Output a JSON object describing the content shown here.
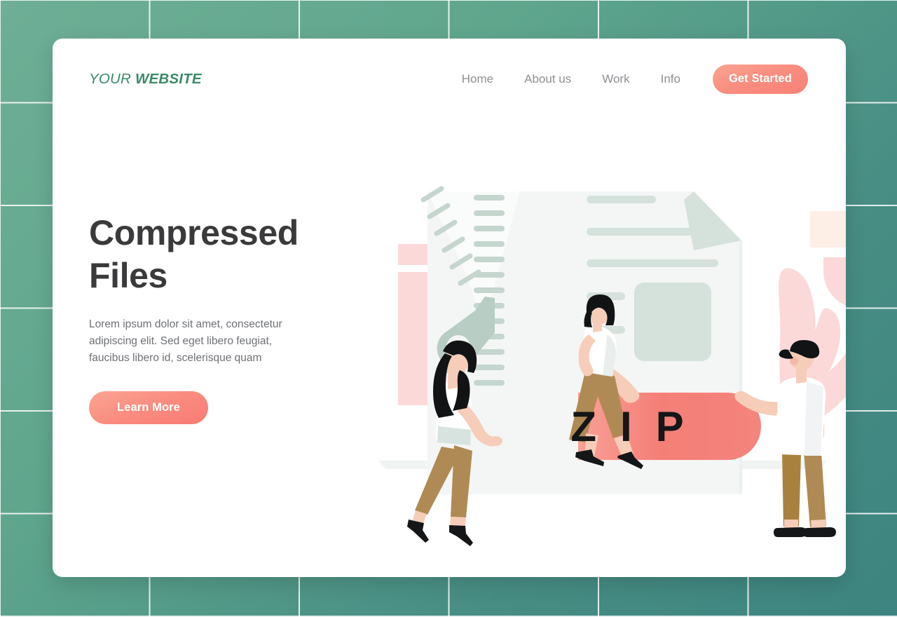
{
  "brand": {
    "logo_regular": "YOUR",
    "logo_bold": "WEBSITE",
    "logo_color": "#3c8a69"
  },
  "nav": {
    "items": [
      {
        "label": "Home"
      },
      {
        "label": "About us"
      },
      {
        "label": "Work"
      },
      {
        "label": "Info"
      }
    ],
    "cta_label": "Get Started",
    "cta_color": "#f98b7c",
    "link_color": "#8d8f93"
  },
  "hero": {
    "headline_line1": "Compressed",
    "headline_line2": "Files",
    "headline_color": "#3a3a3c",
    "paragraph": "Lorem ipsum dolor sit amet, consectetur adipiscing elit. Sed eget libero feugiat, faucibus libero id, scelerisque quam",
    "paragraph_color": "#6e7075",
    "button_label": "Learn More",
    "button_color": "#fa8d80"
  },
  "illustration": {
    "zip_label": "ZIP",
    "zip_banner_color": "#f4867f",
    "document_color": "#f4f6f6",
    "document_accent_color": "#d5e1db",
    "zipper_color": "#b8cdc3",
    "pink_shape_color": "#fbd9d9",
    "peach_shape_color": "#fdeee6",
    "pants_color": "#b08a54",
    "skin_color": "#f6cdb8",
    "hair_color": "#111315",
    "shirt_color": "#ffffff",
    "background_card_color": "#ffffff"
  },
  "background": {
    "grid_gradient_from": "#6eaf96",
    "grid_gradient_to": "#3d8480",
    "grid_line_color": "#ffffff"
  }
}
